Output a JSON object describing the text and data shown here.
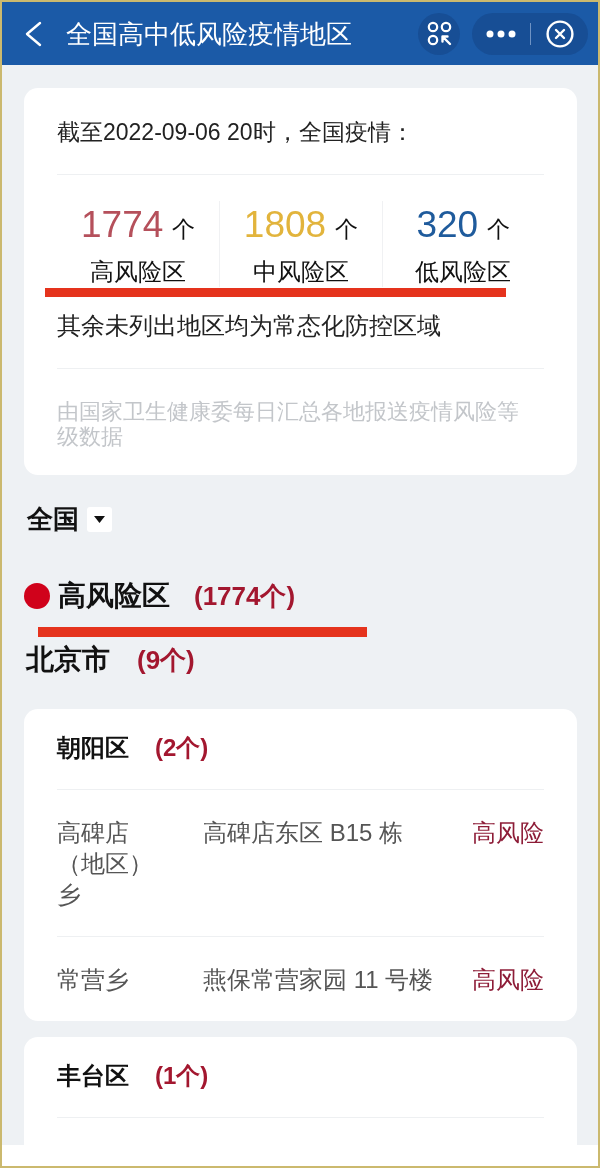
{
  "header": {
    "title": "全国高中低风险疫情地区"
  },
  "summary": {
    "as_of": "截至2022-09-06 20时，全国疫情：",
    "stats": [
      {
        "value": "1774",
        "unit": "个",
        "label": "高风险区",
        "color": "#b5505b"
      },
      {
        "value": "1808",
        "unit": "个",
        "label": "中风险区",
        "color": "#e2b43c"
      },
      {
        "value": "320",
        "unit": "个",
        "label": "低风险区",
        "color": "#1f5b9c"
      }
    ],
    "note": "其余未列出地区均为常态化防控区域",
    "source": "由国家卫生健康委每日汇总各地报送疫情风险等级数据"
  },
  "region_select": {
    "label": "全国"
  },
  "risk_section": {
    "title": "高风险区",
    "count": "(1774个)",
    "color": "#d0021b"
  },
  "province": {
    "name": "北京市",
    "count": "(9个)"
  },
  "districts": [
    {
      "name": "朝阳区",
      "count": "(2个)",
      "rows": [
        {
          "area": "高碑店（地区）乡",
          "address": "高碑店东区 B15 栋",
          "risk": "高风险"
        },
        {
          "area": "常营乡",
          "address": "燕保常营家园 11 号楼",
          "risk": "高风险"
        }
      ]
    },
    {
      "name": "丰台区",
      "count": "(1个)"
    }
  ]
}
